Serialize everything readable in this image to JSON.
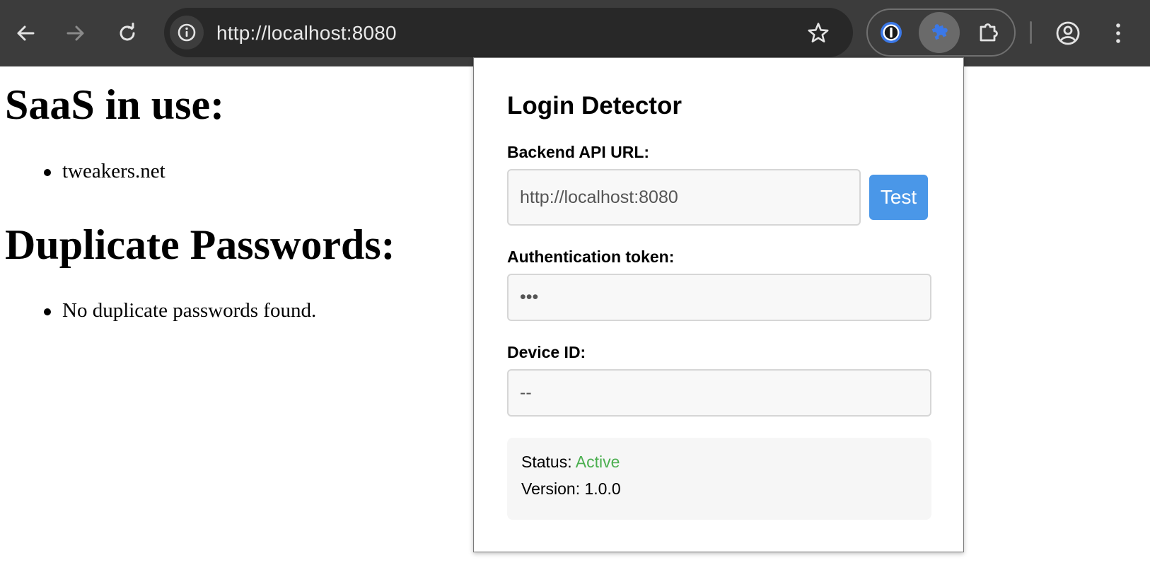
{
  "browser": {
    "url": "http://localhost:8080",
    "icons": {
      "back": "back-arrow-icon",
      "forward": "forward-arrow-icon",
      "reload": "reload-icon",
      "site_info": "info-icon",
      "bookmark": "star-icon",
      "password_manager": "1password-icon",
      "active_extension": "puzzle-piece-blue-icon",
      "extensions_menu": "puzzle-icon",
      "profile": "profile-icon",
      "menu": "kebab-menu-icon"
    }
  },
  "page": {
    "sections": [
      {
        "heading": "SaaS in use:",
        "items": [
          "tweakers.net"
        ]
      },
      {
        "heading": "Duplicate Passwords:",
        "items": [
          "No duplicate passwords found."
        ]
      }
    ]
  },
  "popup": {
    "title": "Login Detector",
    "backend_label": "Backend API URL:",
    "backend_value": "http://localhost:8080",
    "test_button": "Test",
    "token_label": "Authentication token:",
    "token_value": "•••",
    "device_label": "Device ID:",
    "device_value": "--",
    "status_label": "Status:",
    "status_value": "Active",
    "version_label": "Version:",
    "version_value": "1.0.0"
  },
  "colors": {
    "toolbar": "#3c3c3c",
    "omnibox": "#282828",
    "accent_button": "#4a97e8",
    "status_active": "#4caf50",
    "extension_blue": "#3b78e7"
  }
}
